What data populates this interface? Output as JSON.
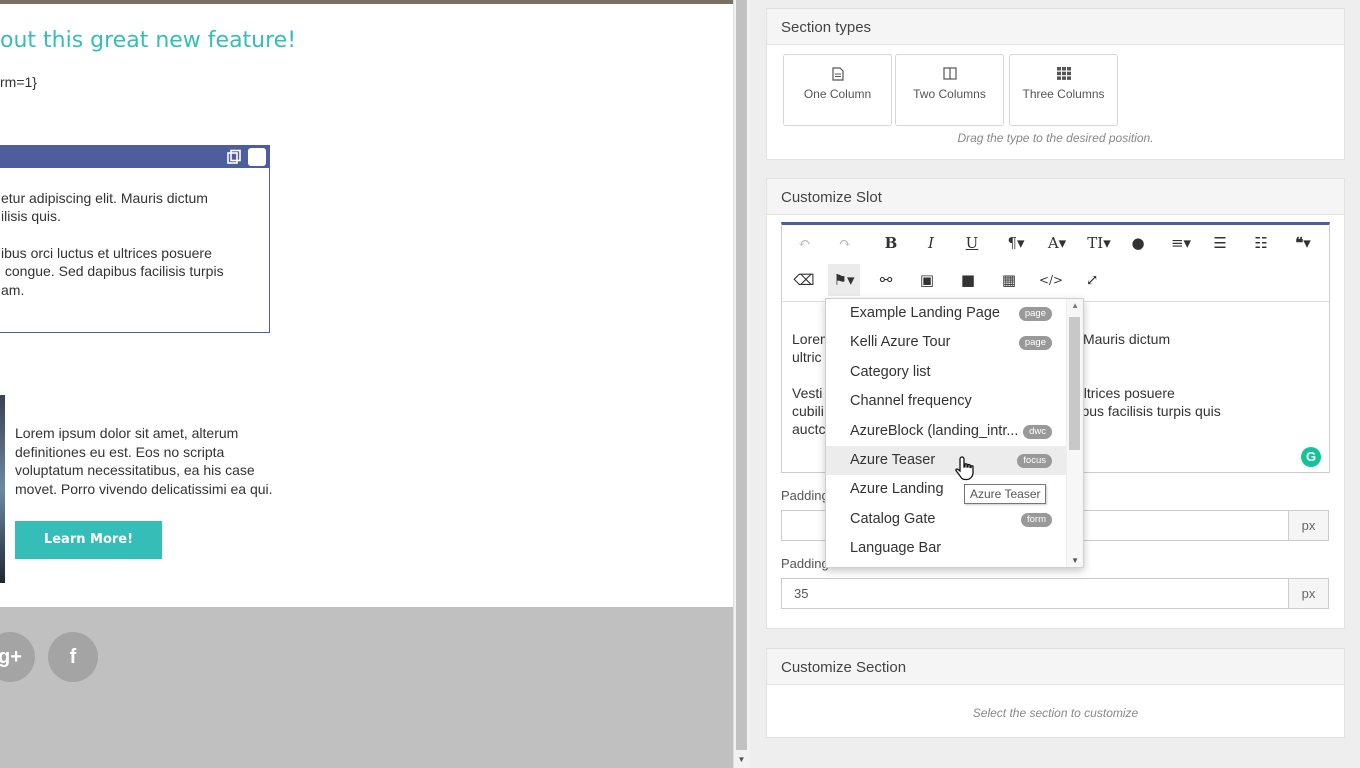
{
  "canvas": {
    "headline": "out this great new feature!",
    "token": "rm=1}",
    "slot_lines": [
      "etur adipiscing elit. Mauris dictum",
      "ilisis quis.",
      "",
      "ibus orci luctus et ultrices posuere",
      " congue. Sed dapibus facilisis turpis",
      "am."
    ],
    "body_text": "Lorem ipsum dolor sit amet, alterum\ndefinitiones eu est. Eos no scripta\nvoluptatum necessitatibus, ea his case\nmovet. Porro vivendo delicatissimi ea qui.",
    "cta_label": "Learn More!",
    "social_g": "g+",
    "social_f": "f"
  },
  "section_types": {
    "title": "Section types",
    "items": [
      {
        "label": "One Column",
        "icon": "document-icon"
      },
      {
        "label": "Two Columns",
        "icon": "columns-icon"
      },
      {
        "label": "Three Columns",
        "icon": "grid-icon"
      }
    ],
    "hint": "Drag the type to the desired position."
  },
  "customize_slot": {
    "title": "Customize Slot",
    "editor_text": "Lorem                                             ipiscing elit. Mauris dictum\nultric                                              uis.\n\nVesti                                              rci luctus et ultrices posuere\ncubili                                              ue. Sed dapibus facilisis turpis quis\nauctc",
    "padding_top_label": "Padding",
    "padding_top_value": "",
    "padding_bottom_label": "Padding bottom",
    "padding_bottom_value": "35",
    "unit": "px"
  },
  "customize_section": {
    "title": "Customize Section",
    "hint": "Select the section to customize"
  },
  "dropdown": {
    "items": [
      {
        "name": "Example Landing Page",
        "badge": "page"
      },
      {
        "name": "Kelli Azure Tour",
        "badge": "page"
      },
      {
        "name": "Category list",
        "badge": ""
      },
      {
        "name": "Channel frequency",
        "badge": ""
      },
      {
        "name": "AzureBlock (landing_intr...",
        "badge": "dwc"
      },
      {
        "name": "Azure Teaser",
        "badge": "focus"
      },
      {
        "name": "Azure Landing",
        "badge": ""
      },
      {
        "name": "Catalog Gate",
        "badge": "form"
      },
      {
        "name": "Language Bar",
        "badge": ""
      }
    ],
    "highlighted_index": 5,
    "tooltip": "Azure Teaser"
  },
  "colors": {
    "accent": "#35bdb8",
    "slot_header": "#4e5d9c",
    "footer": "#c0c0c0"
  }
}
